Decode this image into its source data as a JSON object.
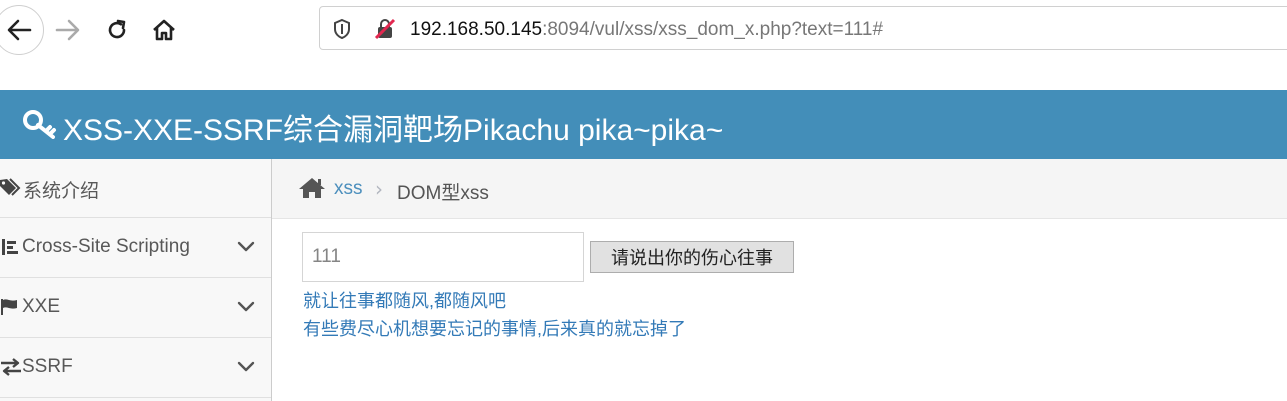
{
  "browser": {
    "url_host": "192.168.50.145",
    "url_rest": ":8094/vul/xss/xss_dom_x.php?text=111#",
    "icons": [
      "back-arrow-icon",
      "forward-arrow-icon",
      "reload-icon",
      "home-icon",
      "shield-icon",
      "insecure-lock-icon"
    ]
  },
  "header": {
    "title": "XSS-XXE-SSRF综合漏洞靶场Pikachu pika~pika~",
    "background": "#438eb9"
  },
  "sidebar": {
    "items": [
      {
        "label": "系统介绍",
        "icon": "tag-icon"
      },
      {
        "label": "Cross-Site Scripting",
        "icon": "list-icon"
      },
      {
        "label": "XXE",
        "icon": "flag-icon"
      },
      {
        "label": "SSRF",
        "icon": "exchange-icon"
      }
    ]
  },
  "breadcrumb": {
    "link": "xss",
    "separator": "›",
    "current": "DOM型xss"
  },
  "form": {
    "input_value": "111",
    "button_label": "请说出你的伤心往事"
  },
  "results": {
    "line1": "就让往事都随风,都随风吧",
    "line2": "有些费尽心机想要忘记的事情,后来真的就忘掉了",
    "link_color": "#337ab7"
  }
}
